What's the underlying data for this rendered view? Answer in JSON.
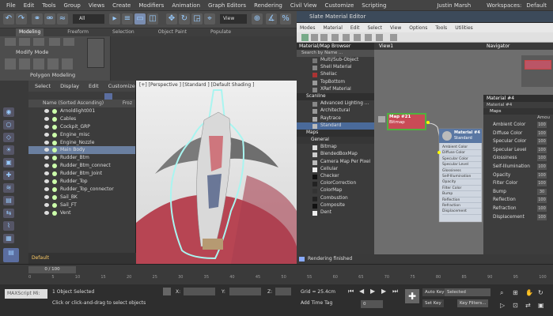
{
  "menubar": {
    "items": [
      "File",
      "Edit",
      "Tools",
      "Group",
      "Views",
      "Create",
      "Modifiers",
      "Animation",
      "Graph Editors",
      "Rendering",
      "Civil View",
      "Customize",
      "Scripting"
    ],
    "user": "Justin Marsh",
    "workspaces_label": "Workspaces:",
    "workspace": "Default"
  },
  "toolbar": {
    "selection_filter": "All",
    "view_dropdown": "View"
  },
  "ribbon": {
    "tabs": [
      "Modeling",
      "Freeform",
      "Selection",
      "Object Paint",
      "Populate"
    ],
    "modify_mode": "Modify Mode",
    "panel": "Polygon Modeling"
  },
  "scene_explorer": {
    "menus": [
      "Select",
      "Display",
      "Edit",
      "Customize"
    ],
    "column_header": "Name (Sorted Ascending)",
    "frozen_header": "Froz",
    "items": [
      {
        "name": "Arnoldlight001",
        "selected": false
      },
      {
        "name": "Cables",
        "selected": false
      },
      {
        "name": "Cockpit_GRP",
        "selected": false
      },
      {
        "name": "Engine_misc",
        "selected": false
      },
      {
        "name": "Engine_Nozzle",
        "selected": false
      },
      {
        "name": "Main Body",
        "selected": true
      },
      {
        "name": "Rudder_Btm",
        "selected": false
      },
      {
        "name": "Rudder_Btm_connect",
        "selected": false
      },
      {
        "name": "Rudder_Btm_Joint",
        "selected": false
      },
      {
        "name": "Rudder_Top",
        "selected": false
      },
      {
        "name": "Rudder_Top_connector",
        "selected": false
      },
      {
        "name": "Sail_BK",
        "selected": false
      },
      {
        "name": "Sail_FT",
        "selected": false
      },
      {
        "name": "Vent",
        "selected": false
      }
    ],
    "layer": "Default"
  },
  "viewport": {
    "label": "[+] [Perspective ] [Standard ] [Default Shading ]"
  },
  "sme": {
    "title": "Slate Material Editor",
    "menus": [
      "Modes",
      "Material",
      "Edit",
      "Select",
      "View",
      "Options",
      "Tools",
      "Utilities"
    ],
    "browser_title": "Material/Map Browser",
    "search_placeholder": "Search by Name ...",
    "materials": [
      {
        "name": "Multi/Sub-Object",
        "color": "#777"
      },
      {
        "name": "Shell Material",
        "color": "#888"
      },
      {
        "name": "Shellac",
        "color": "#a33"
      },
      {
        "name": "TopBottom",
        "color": "#999"
      },
      {
        "name": "XRef Material",
        "color": "#888"
      }
    ],
    "scanline_header": "Scanline",
    "scanline": [
      {
        "name": "Advanced Lighting ...",
        "color": "#888",
        "selected": false
      },
      {
        "name": "Architectural",
        "color": "#999",
        "selected": false
      },
      {
        "name": "Raytrace",
        "color": "#aaa",
        "selected": false
      },
      {
        "name": "Standard",
        "color": "#bbb",
        "selected": true
      }
    ],
    "maps_header": "Maps",
    "general_header": "General",
    "maps": [
      {
        "name": "Bitmap",
        "color": "#ddd"
      },
      {
        "name": "BlendedBoxMap",
        "color": "#ccc"
      },
      {
        "name": "Camera Map Per Pixel",
        "color": "#bbb"
      },
      {
        "name": "Cellular",
        "color": "#eee"
      },
      {
        "name": "Checker",
        "color": "#111"
      },
      {
        "name": "ColorCorrection",
        "color": "#222"
      },
      {
        "name": "ColorMap",
        "color": "#333"
      },
      {
        "name": "Combustion",
        "color": "#222"
      },
      {
        "name": "Composite",
        "color": "#111"
      },
      {
        "name": "Dent",
        "color": "#eee"
      }
    ],
    "view_tab": "View1",
    "bitmap_node": {
      "title": "Map #21",
      "subtitle": "Bitmap"
    },
    "material_node": {
      "title": "Material #4",
      "subtitle": "Standard",
      "slots": [
        "Ambient Color",
        "Diffuse Color",
        "Specular Color",
        "Specular Level",
        "Glossiness",
        "Self-Illumination",
        "Opacity",
        "Filter Color",
        "Bump",
        "Reflection",
        "Refraction",
        "Displacement"
      ]
    },
    "navigator_title": "Navigator",
    "props": {
      "title": "Material #4",
      "subtitle": "Material #4",
      "section": "Maps",
      "amount_header": "Amou",
      "rows": [
        {
          "label": "Ambient Color",
          "value": "100"
        },
        {
          "label": "Diffuse Color",
          "value": "100"
        },
        {
          "label": "Specular Color",
          "value": "100"
        },
        {
          "label": "Specular Level",
          "value": "100"
        },
        {
          "label": "Glossiness",
          "value": "100"
        },
        {
          "label": "Self-Illumination",
          "value": "100"
        },
        {
          "label": "Opacity",
          "value": "100"
        },
        {
          "label": "Filter Color",
          "value": "100"
        },
        {
          "label": "Bump",
          "value": "30"
        },
        {
          "label": "Reflection",
          "value": "100"
        },
        {
          "label": "Refraction",
          "value": "100"
        },
        {
          "label": "Displacement",
          "value": "100"
        }
      ]
    },
    "status": "Rendering finished"
  },
  "timeline": {
    "frame": "0 / 100",
    "ticks": [
      "0",
      "5",
      "10",
      "15",
      "20",
      "25",
      "30",
      "35",
      "40",
      "45",
      "50",
      "55",
      "60",
      "65",
      "70",
      "75",
      "80",
      "85",
      "90",
      "95",
      "100"
    ]
  },
  "statusbar": {
    "maxscript": "MAXScript Mi:",
    "selected": "1 Object Selected",
    "prompt": "Click or click-and-drag to select objects",
    "x_label": "X:",
    "y_label": "Y:",
    "z_label": "Z:",
    "grid": "Grid = 25.4cm",
    "add_time_tag": "Add Time Tag",
    "auto_key": "Auto Key",
    "set_key": "Set Key",
    "key_mode": "Selected",
    "key_filters": "Key Filters...",
    "frame_value": "0"
  },
  "colors": {
    "selection_blue": "#6a7fa0",
    "outline_cyan": "#a9f5f0",
    "bitmap_header": "#c94b56",
    "material_header": "#5a77a3",
    "bitmap_connector_green": "#4fb13f"
  }
}
